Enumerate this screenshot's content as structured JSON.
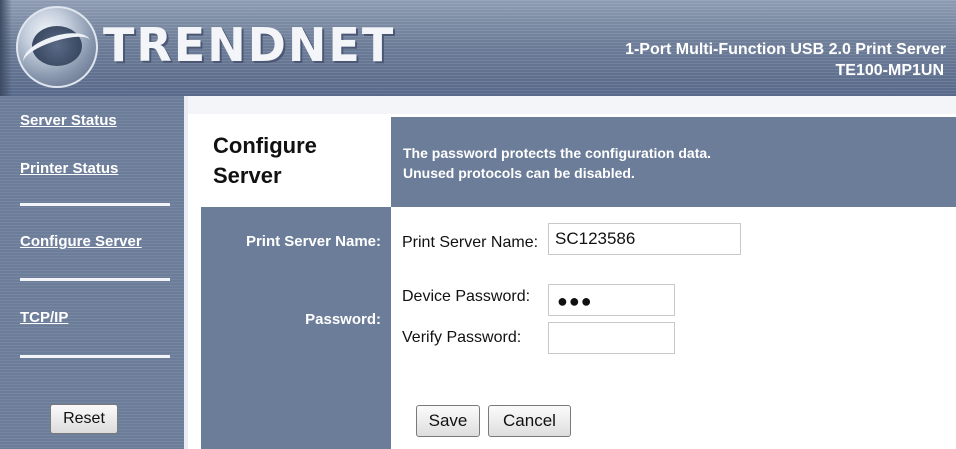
{
  "header": {
    "brand": "TRENDNET",
    "product_title": "1-Port Multi-Function USB 2.0 Print Server",
    "product_model": "TE100-MP1UN"
  },
  "sidebar": {
    "items": [
      {
        "label": "Server Status"
      },
      {
        "label": "Printer Status"
      },
      {
        "label": "Configure Server"
      },
      {
        "label": "TCP/IP"
      }
    ],
    "reset_label": "Reset"
  },
  "page": {
    "title": "Configure Server",
    "description": [
      "The password protects the configuration data.",
      "Unused protocols can be disabled."
    ]
  },
  "form": {
    "print_server_name_label": "Print Server Name:",
    "password_label": "Password:",
    "name_field_label": "Print Server Name:",
    "name_value": "SC123586",
    "device_password_label": "Device Password:",
    "device_password_mask": "●●●",
    "verify_password_label": "Verify Password:",
    "verify_password_value": "",
    "save_label": "Save",
    "cancel_label": "Cancel"
  }
}
